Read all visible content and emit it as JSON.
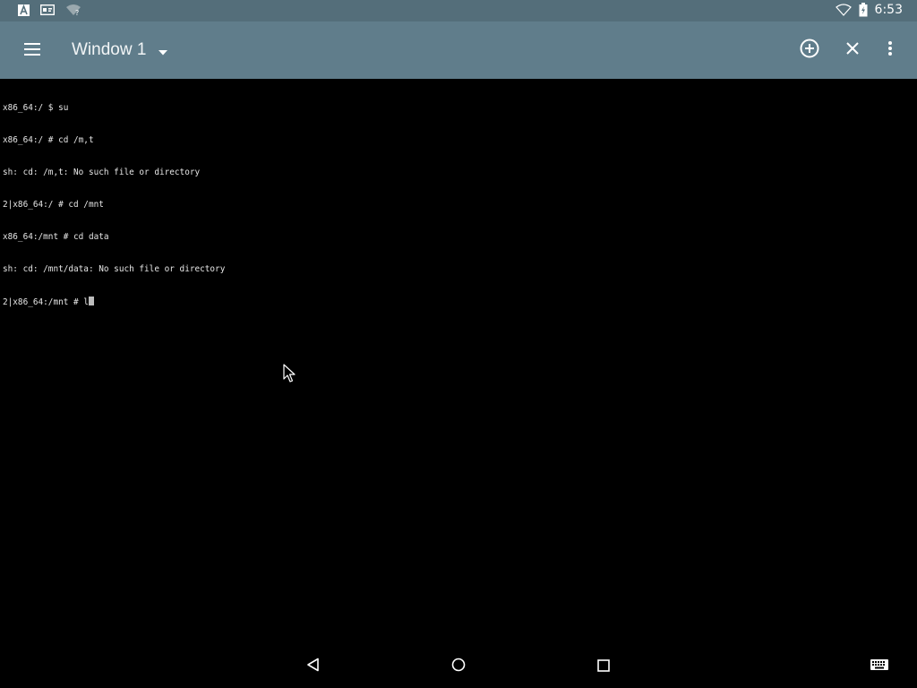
{
  "status_bar": {
    "left_icons": [
      "a-notification-icon",
      "sim-notification-icon",
      "wifi-question-icon"
    ],
    "right_icons": [
      "wifi-icon",
      "battery-charging-icon"
    ],
    "time": "6:53"
  },
  "app_bar": {
    "window_title": "Window 1",
    "actions": [
      "add-window-icon",
      "close-window-icon",
      "more-options-icon"
    ]
  },
  "terminal": {
    "lines": [
      "x86_64:/ $ su",
      "x86_64:/ # cd /m,t",
      "sh: cd: /m,t: No such file or directory",
      "2|x86_64:/ # cd /mnt",
      "x86_64:/mnt # cd data",
      "sh: cd: /mnt/data: No such file or directory"
    ],
    "prompt_line": "2|x86_64:/mnt # l"
  },
  "nav_bar": {
    "buttons": [
      "back-icon",
      "home-icon",
      "recents-icon",
      "keyboard-icon"
    ]
  },
  "colors": {
    "status_bar": "#546e7a",
    "app_bar": "#607d8b",
    "terminal_bg": "#000000",
    "terminal_fg": "#e6e6e6"
  }
}
